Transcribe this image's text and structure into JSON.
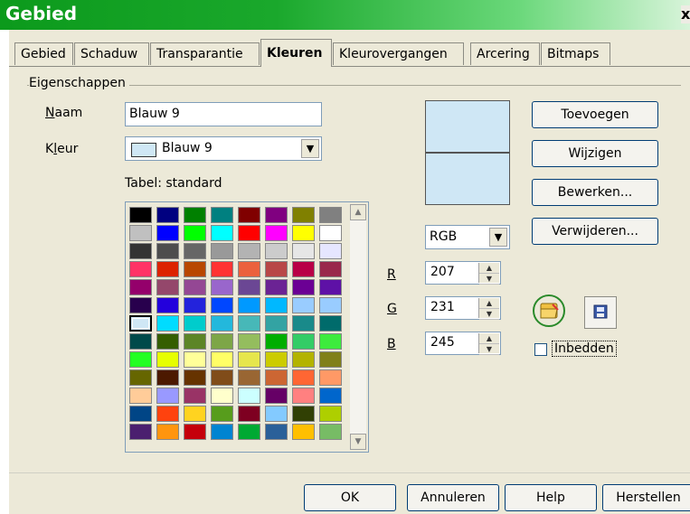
{
  "window": {
    "title": "Gebied",
    "close": "x"
  },
  "tabs": [
    {
      "label": "Gebied"
    },
    {
      "label": "Schaduw"
    },
    {
      "label": "Transparantie"
    },
    {
      "label": "Kleuren",
      "active": true
    },
    {
      "label": "Kleurovergangen"
    },
    {
      "label": "Arcering"
    },
    {
      "label": "Bitmaps"
    }
  ],
  "properties": {
    "group_label": "Eigenschappen",
    "name_label": "Naam",
    "name_value": "Blauw 9",
    "color_label": "Kleur",
    "color_value": "Blauw 9",
    "table_label": "Tabel: standard"
  },
  "palette": [
    [
      "#000000",
      "#000080",
      "#008000",
      "#008080",
      "#800000",
      "#800080",
      "#808000",
      "#808080"
    ],
    [
      "#c0c0c0",
      "#0000ff",
      "#00ff00",
      "#00ffff",
      "#ff0000",
      "#ff00ff",
      "#ffff00",
      "#ffffff"
    ],
    [
      "#333333",
      "#4d4d4d",
      "#666666",
      "#999999",
      "#b3b3b3",
      "#cccccc",
      "#e6e6e6",
      "#e6e6ff"
    ],
    [
      "#ff3366",
      "#dc2300",
      "#b84700",
      "#ff3333",
      "#eb613d",
      "#b84747",
      "#b80047",
      "#99284c"
    ],
    [
      "#94006b",
      "#94476b",
      "#944794",
      "#9966cc",
      "#6b4794",
      "#6b2394",
      "#6b0094",
      "#5e11a6"
    ],
    [
      "#28004d",
      "#2300dc",
      "#2323dc",
      "#0047ff",
      "#0099ff",
      "#00b8ff",
      "#99ccff",
      "#99ccff"
    ],
    [
      "#cfe7f5",
      "#00dcff",
      "#00cccc",
      "#23b8dc",
      "#47b8b8",
      "#33a3a3",
      "#198a8a",
      "#006b6b"
    ],
    [
      "#004a4a",
      "#355e00",
      "#5c8526",
      "#7da647",
      "#94bd5e",
      "#00ae00",
      "#33cc66",
      "#3deb3d"
    ],
    [
      "#23ff23",
      "#e6ff00",
      "#ffff99",
      "#ffff66",
      "#e6e64c",
      "#cccc00",
      "#b3b300",
      "#808019"
    ],
    [
      "#666600",
      "#4c1900",
      "#663300",
      "#804c19",
      "#996633",
      "#cc6633",
      "#ff6633",
      "#ff9966"
    ],
    [
      "#ffcc99",
      "#9999ff",
      "#993366",
      "#ffffcc",
      "#ccffff",
      "#660066",
      "#ff8080",
      "#0066cc"
    ],
    [
      "#004586",
      "#ff420e",
      "#ffd320",
      "#579d1c",
      "#7e0021",
      "#83caff",
      "#314004",
      "#aecf00"
    ],
    [
      "#4b1f6f",
      "#ff950e",
      "#c5000b",
      "#0084d1",
      "#00a933",
      "#2a6099",
      "#ffbf00",
      "#77bc65"
    ]
  ],
  "selected_color": "#cfe7f5",
  "colors": {
    "accent": "#0c9a1c",
    "dialog_bg": "#ece9d8"
  },
  "color_model": {
    "value": "RGB"
  },
  "rgb": [
    {
      "label": "R",
      "value": "207"
    },
    {
      "label": "G",
      "value": "231"
    },
    {
      "label": "B",
      "value": "245"
    }
  ],
  "actions": {
    "add": "Toevoegen",
    "modify": "Wijzigen",
    "edit": "Bewerken...",
    "delete": "Verwijderen...",
    "embed": "Inbedden"
  },
  "icons": {
    "open": "open-folder-icon",
    "save": "save-disk-icon"
  },
  "footer": {
    "ok": "OK",
    "cancel": "Annuleren",
    "help": "Help",
    "reset": "Herstellen"
  }
}
